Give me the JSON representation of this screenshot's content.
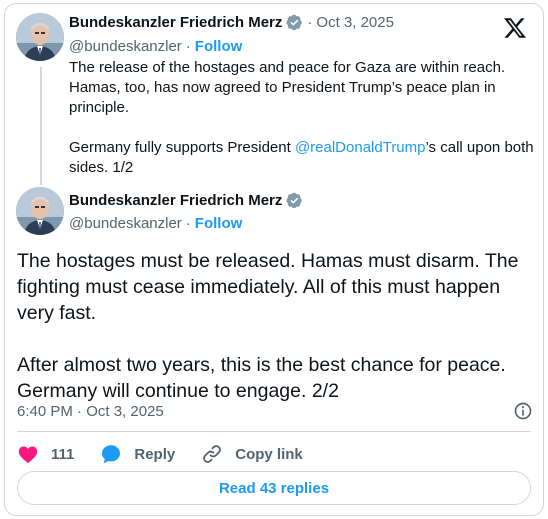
{
  "reply_tweet": {
    "author_name": "Bundeskanzler Friedrich Merz",
    "date": "Oct 3, 2025",
    "handle": "@bundeskanzler",
    "follow_label": "Follow",
    "paragraph1": "The release of the hostages and peace for Gaza are within reach. Hamas, too, has now agreed to President Trump’s peace plan in principle.",
    "paragraph2_before": "Germany fully supports President ",
    "paragraph2_mention": "@realDonaldTrump",
    "paragraph2_after": "’s call upon both sides. 1/2"
  },
  "main_tweet": {
    "author_name": "Bundeskanzler Friedrich Merz",
    "handle": "@bundeskanzler",
    "follow_label": "Follow",
    "paragraph1": "The hostages must be released. Hamas must disarm. The fighting must cease immediately. All of this must happen very fast.",
    "paragraph2": "After almost two years, this is the best chance for peace. Germany will continue to engage. 2/2",
    "timestamp": "6:40 PM · Oct 3, 2025"
  },
  "actions": {
    "like_count": "111",
    "reply_label": "Reply",
    "copy_link_label": "Copy link"
  },
  "read_replies_label": "Read 43 replies",
  "colors": {
    "accent": "#1d9bf0",
    "like": "#f91880",
    "muted": "#536471",
    "border": "#cfd9de"
  },
  "icons": [
    "x-logo-icon",
    "verified-badge-icon",
    "heart-icon",
    "reply-bubble-icon",
    "link-icon",
    "info-icon"
  ]
}
